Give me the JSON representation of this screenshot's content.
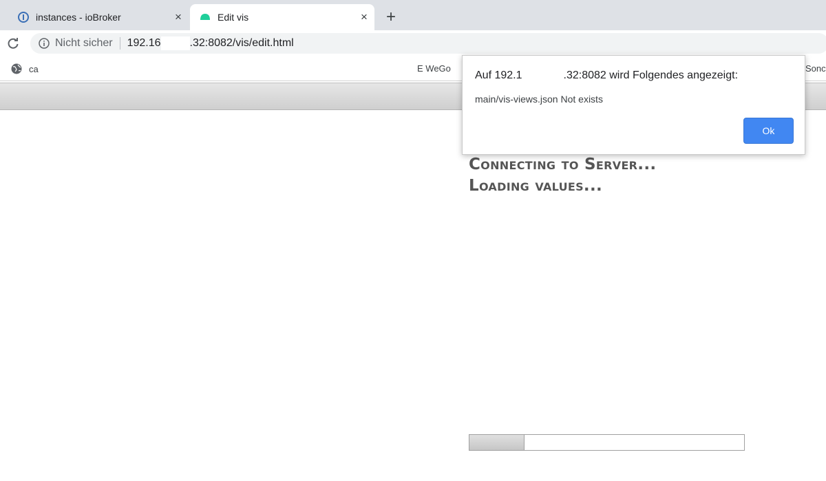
{
  "browser": {
    "tabs": [
      {
        "title": "instances - ioBroker",
        "close": "×",
        "active": false,
        "icon": "iobroker-icon"
      },
      {
        "title": "Edit vis",
        "close": "×",
        "active": true,
        "icon": "vis-icon"
      }
    ],
    "new_tab": "+",
    "address_bar": {
      "security_label": "Nicht sicher",
      "host_start": "192.16",
      "url_rest": ".32:8082/vis/edit.html"
    },
    "bookmarks": [
      {
        "label": "ca",
        "icon": "globe-icon"
      },
      {
        "label": "E WeGo"
      },
      {
        "label": "Sonc"
      }
    ]
  },
  "page": {
    "status_lines": [
      "Connecting to Server...",
      "Loading values..."
    ],
    "progress_fraction": 0.2
  },
  "dialog": {
    "heading_start": "Auf 192.1",
    "heading_end": ".32:8082 wird Folgendes angezeigt:",
    "message": "main/vis-views.json Not exists",
    "ok_label": "Ok",
    "ok_color": "#4187f2"
  }
}
